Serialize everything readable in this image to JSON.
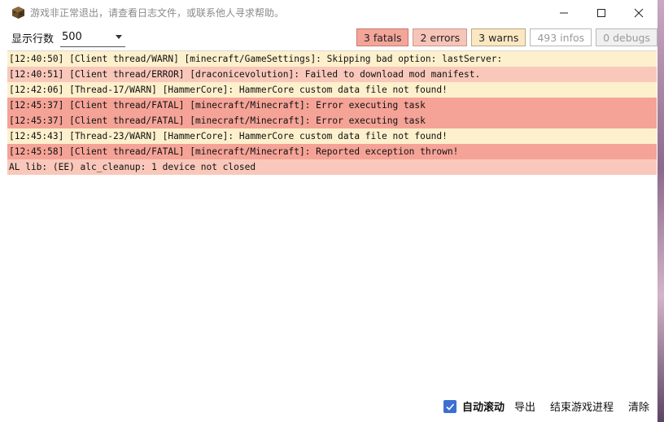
{
  "window": {
    "title": "游戏非正常退出，请查看日志文件，或联系他人寻求帮助。",
    "controls": {
      "minimize": "—",
      "maximize": "☐",
      "close": "✕"
    }
  },
  "toolbar": {
    "rows_label": "显示行数",
    "rows_value": "500",
    "filters": {
      "fatal": "3 fatals",
      "error": "2 errors",
      "warn": "3 warns",
      "info": "493 infos",
      "debug": "0 debugs"
    }
  },
  "log": {
    "rows": [
      {
        "text": "[12:40:50] [Client thread/WARN] [minecraft/GameSettings]: Skipping bad option: lastServer:",
        "level": "warn"
      },
      {
        "text": "[12:40:51] [Client thread/ERROR] [draconicevolution]: Failed to download mod manifest.",
        "level": "error"
      },
      {
        "text": "[12:42:06] [Thread-17/WARN] [HammerCore]: HammerCore custom data file not found!",
        "level": "warn"
      },
      {
        "text": "[12:45:37] [Client thread/FATAL] [minecraft/Minecraft]: Error executing task",
        "level": "fatal"
      },
      {
        "text": "[12:45:37] [Client thread/FATAL] [minecraft/Minecraft]: Error executing task",
        "level": "fatal"
      },
      {
        "text": "[12:45:43] [Thread-23/WARN] [HammerCore]: HammerCore custom data file not found!",
        "level": "warn"
      },
      {
        "text": "[12:45:58] [Client thread/FATAL] [minecraft/Minecraft]: Reported exception thrown!",
        "level": "fatal"
      },
      {
        "text": "AL lib: (EE) alc_cleanup: 1 device not closed",
        "level": "other"
      }
    ]
  },
  "bottom": {
    "auto_scroll_label": "自动滚动",
    "auto_scroll_checked": true,
    "export_label": "导出",
    "kill_label": "结束游戏进程",
    "clear_label": "清除"
  },
  "colors": {
    "fatal": "#f5a397",
    "error": "#f9c8bb",
    "warn": "#fdf0cc",
    "accent": "#3d6fd1"
  }
}
